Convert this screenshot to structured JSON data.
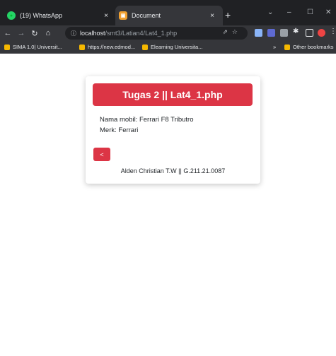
{
  "browser": {
    "tabs": [
      {
        "title": "(19) WhatsApp",
        "icon": "whatsapp-icon",
        "active": false
      },
      {
        "title": "Document",
        "icon": "document-icon",
        "active": true
      }
    ],
    "new_tab": "+",
    "close_glyph": "×",
    "window_controls": {
      "chevron": "⌄",
      "minimize": "–",
      "maximize": "☐",
      "close": "✕"
    },
    "url_host": "localhost",
    "url_path": "/smt3/Latian4/Lat4_1.php",
    "bookmarks": [
      {
        "label": "SIMA 1.0| Universit..."
      },
      {
        "label": "https://new.edmod..."
      },
      {
        "label": "Elearning Universita..."
      }
    ],
    "bookmarks_overflow": "»",
    "other_bookmarks": "Other bookmarks"
  },
  "page": {
    "header_title": "Tugas 2 || Lat4_1.php",
    "car_name": "Nama mobil: Ferrari F8 Tributro",
    "brand": "Merk: Ferrari",
    "back_label": "<",
    "footer": "Alden Christian T.W || G.211.21.0087"
  },
  "colors": {
    "accent": "#dc3545",
    "chrome_dark": "#202124",
    "chrome_toolbar": "#35363a"
  }
}
